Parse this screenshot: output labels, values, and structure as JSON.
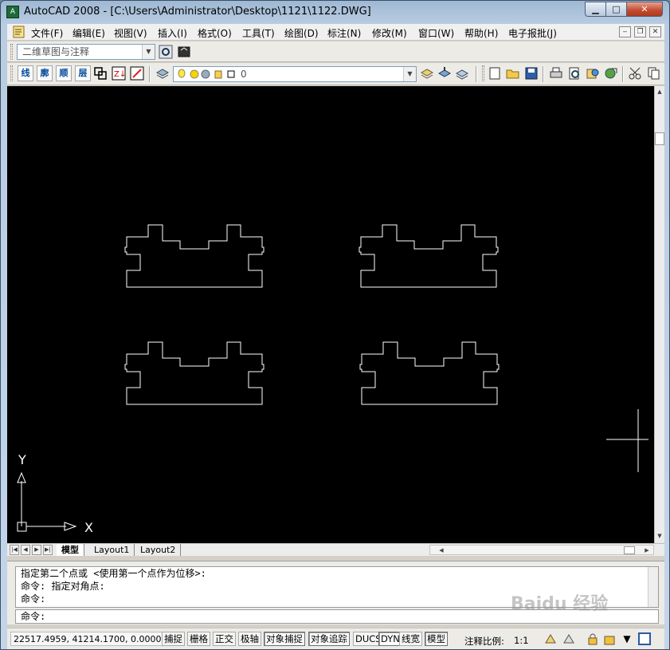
{
  "window": {
    "title": "AutoCAD 2008 - [C:\\Users\\Administrator\\Desktop\\1121\\1122.DWG]",
    "min_label": "▁",
    "max_label": "□",
    "close_label": "✕"
  },
  "menubar": {
    "items": [
      "文件(F)",
      "编辑(E)",
      "视图(V)",
      "插入(I)",
      "格式(O)",
      "工具(T)",
      "绘图(D)",
      "标注(N)",
      "修改(M)",
      "窗口(W)",
      "帮助(H)",
      "电子报批(J)"
    ],
    "mdi_min": "‒",
    "mdi_restore": "❐",
    "mdi_close": "✕"
  },
  "toolbar": {
    "workspace_value": "二维草图与注释",
    "custom_buttons": [
      "线",
      "廓",
      "顺",
      "层"
    ],
    "layer_value": "0",
    "icons": [
      "workspace-settings-icon",
      "workspace-icon",
      "layer-properties-icon",
      "bulb-icon",
      "sun-icon",
      "lock-icon",
      "color-square-icon",
      "new-icon",
      "open-icon",
      "save-icon",
      "print-icon",
      "preview-icon",
      "publish-icon",
      "cut-icon"
    ]
  },
  "ucs": {
    "y_label": "Y",
    "x_label": "X"
  },
  "tabs": {
    "model": "模型",
    "layout1": "Layout1",
    "layout2": "Layout2"
  },
  "command": {
    "history": [
      "指定第二个点或 <使用第一个点作为位移>:",
      "命令: 指定对角点:",
      "命令:"
    ],
    "prompt": "命令:"
  },
  "status": {
    "coords": "22517.4959, 41214.1700, 0.0000",
    "buttons": [
      {
        "label": "捕捉",
        "on": false
      },
      {
        "label": "栅格",
        "on": false
      },
      {
        "label": "正交",
        "on": false
      },
      {
        "label": "极轴",
        "on": false
      },
      {
        "label": "对象捕捉",
        "on": true
      },
      {
        "label": "对象追踪",
        "on": true
      },
      {
        "label": "DUCS",
        "on": false
      },
      {
        "label": "DYN",
        "on": true
      },
      {
        "label": "线宽",
        "on": false
      },
      {
        "label": "模型",
        "on": true
      }
    ],
    "scale_label": "注释比例:",
    "scale_value": "1:1"
  },
  "watermark": "Baidu 经验",
  "colors": {
    "drawing_bg": "#000000",
    "drawing_lines": "#ffffff"
  }
}
